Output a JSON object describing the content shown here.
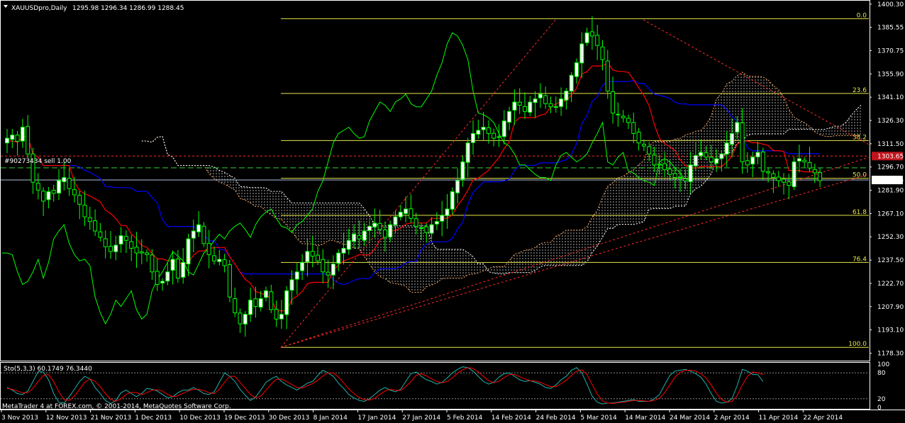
{
  "header": {
    "symbol": "XAUUSDpro,Daily",
    "ohlc": "1295.98 1296.34 1286.99 1288.45",
    "menu_icon": "triangle-down-icon"
  },
  "order_line": {
    "label": "#90273434 sell 1.00"
  },
  "footer": {
    "copyright": "MetaTrader 4 at FOREX.com, © 2001-2014, MetaQuotes Software Corp."
  },
  "colors": {
    "background": "#000000",
    "candle": "#00ff00",
    "candle_body": "#ffffff",
    "tenkan": "#ff0000",
    "kijun": "#0000ff",
    "chikou": "#00ff00",
    "fib": "#e6e64a",
    "grid_text": "#ffffff",
    "stoch_main": "#20b2aa",
    "stoch_signal": "#ff0000",
    "order_label_bg": "#c0131c"
  },
  "chart_data": [
    {
      "type": "candlestick",
      "title": "XAUUSDpro,Daily",
      "ylim": [
        1174,
        1402
      ],
      "y_ticks": [
        "1400.30",
        "1385.55",
        "1370.75",
        "1355.90",
        "1341.10",
        "1326.30",
        "1311.50",
        "1296.70",
        "1281.90",
        "1267.10",
        "1252.30",
        "1237.50",
        "1222.70",
        "1207.90",
        "1193.10",
        "1178.30"
      ],
      "x_ticks": [
        "3 Nov 2013",
        "12 Nov 2013",
        "21 Nov 2013",
        "1 Dec 2013",
        "10 Dec 2013",
        "19 Dec 2013",
        "30 Dec 2013",
        "8 Jan 2014",
        "17 Jan 2014",
        "27 Jan 2014",
        "5 Feb 2014",
        "14 Feb 2014",
        "24 Feb 2014",
        "5 Mar 2014",
        "14 Mar 2014",
        "24 Mar 2014",
        "2 Apr 2014",
        "11 Apr 2014",
        "22 Apr 2014"
      ],
      "series": [
        {
          "name": "XAUUSDpro",
          "closes": [
            1315,
            1317,
            1313,
            1322,
            1305,
            1287,
            1282,
            1275,
            1281,
            1280,
            1288,
            1290,
            1283,
            1279,
            1273,
            1265,
            1262,
            1256,
            1252,
            1246,
            1243,
            1247,
            1253,
            1250,
            1245,
            1242,
            1242,
            1241,
            1230,
            1222,
            1224,
            1230,
            1238,
            1226,
            1236,
            1251,
            1256,
            1260,
            1248,
            1241,
            1237,
            1238,
            1234,
            1214,
            1204,
            1197,
            1203,
            1212,
            1208,
            1213,
            1218,
            1206,
            1200,
            1203,
            1218,
            1225,
            1230,
            1236,
            1243,
            1240,
            1237,
            1230,
            1228,
            1235,
            1242,
            1245,
            1250,
            1254,
            1251,
            1256,
            1259,
            1261,
            1257,
            1252,
            1260,
            1265,
            1268,
            1270,
            1264,
            1259,
            1258,
            1255,
            1260,
            1262,
            1266,
            1270,
            1281,
            1288,
            1300,
            1312,
            1318,
            1320,
            1322,
            1318,
            1315,
            1316,
            1326,
            1332,
            1338,
            1336,
            1332,
            1338,
            1340,
            1343,
            1337,
            1335,
            1335,
            1340,
            1345,
            1355,
            1363,
            1375,
            1382,
            1380,
            1374,
            1365,
            1345,
            1331,
            1330,
            1328,
            1325,
            1318,
            1312,
            1310,
            1305,
            1298,
            1298,
            1295,
            1292,
            1290,
            1290,
            1288,
            1298,
            1304,
            1306,
            1303,
            1300,
            1302,
            1305,
            1312,
            1318,
            1325,
            1300,
            1298,
            1303,
            1306,
            1294,
            1293,
            1290,
            1288,
            1287,
            1285,
            1300,
            1302,
            1300,
            1296,
            1293,
            1288
          ],
          "last_price": "1288.45",
          "order_price": "1303.65"
        }
      ],
      "indicators": {
        "tenkan_sen": "red line",
        "kijun_sen": "blue line",
        "chikou_span": "green line",
        "kumo": "hatched cloud"
      },
      "annotations": {
        "fibonacci_levels": [
          {
            "label": "0.0",
            "price": 1391
          },
          {
            "label": "23.6",
            "price": 1343.5
          },
          {
            "label": "38.2",
            "price": 1313.5
          },
          {
            "label": "50.0",
            "price": 1289.5
          },
          {
            "label": "61.8",
            "price": 1266
          },
          {
            "label": "76.4",
            "price": 1236
          },
          {
            "label": "100.0",
            "price": 1182
          }
        ],
        "order_line_price": 1303.65,
        "trend_lines": "red dashed fan from 30 Dec 2013 low"
      }
    },
    {
      "type": "line",
      "title": "Sto(5,3,3) 60.1749 76.3440",
      "ylim": [
        0,
        100
      ],
      "y_ticks": [
        "100",
        "80",
        "20",
        "0"
      ],
      "series": [
        {
          "name": "main",
          "values": [
            46,
            40,
            32,
            30,
            38,
            60,
            83,
            82,
            64,
            32,
            12,
            10,
            25,
            42,
            60,
            72,
            66,
            46,
            32,
            16,
            9,
            16,
            34,
            40,
            32,
            25,
            32,
            44,
            42,
            38,
            30,
            22,
            25,
            34,
            40,
            40,
            46,
            40,
            32,
            30,
            36,
            58,
            80,
            72,
            60,
            42,
            28,
            16,
            24,
            40,
            58,
            66,
            72,
            60,
            52,
            46,
            40,
            48,
            56,
            60,
            74,
            86,
            80,
            72,
            56,
            44,
            30,
            22,
            16,
            14,
            20,
            30,
            40,
            46,
            40,
            36,
            42,
            60,
            78,
            82,
            72,
            64,
            60,
            54,
            58,
            68,
            80,
            88,
            94,
            92,
            84,
            72,
            60,
            54,
            58,
            70,
            78,
            80,
            72,
            64,
            60,
            62,
            58,
            54,
            46,
            44,
            52,
            64,
            72,
            86,
            92,
            80,
            54,
            26,
            12,
            8,
            10,
            10,
            12,
            14,
            16,
            18,
            14,
            14,
            14,
            20,
            30,
            52,
            74,
            84,
            86,
            88,
            84,
            78,
            70,
            54,
            32,
            14,
            10,
            12,
            20,
            50,
            88,
            84,
            76,
            76,
            60
          ]
        },
        {
          "name": "signal",
          "values": [
            44,
            42,
            38,
            34,
            34,
            44,
            60,
            74,
            76,
            60,
            36,
            18,
            16,
            26,
            42,
            58,
            66,
            60,
            48,
            32,
            19,
            14,
            20,
            30,
            35,
            34,
            30,
            34,
            40,
            41,
            38,
            30,
            25,
            27,
            33,
            38,
            42,
            42,
            39,
            34,
            32,
            42,
            58,
            72,
            72,
            58,
            44,
            30,
            22,
            26,
            40,
            54,
            65,
            66,
            60,
            53,
            46,
            45,
            50,
            55,
            63,
            73,
            80,
            80,
            70,
            57,
            43,
            32,
            23,
            18,
            17,
            21,
            30,
            38,
            42,
            40,
            39,
            48,
            60,
            74,
            78,
            73,
            66,
            60,
            57,
            60,
            68,
            79,
            87,
            92,
            90,
            82,
            72,
            62,
            57,
            61,
            69,
            76,
            76,
            71,
            66,
            62,
            61,
            58,
            53,
            48,
            48,
            55,
            63,
            74,
            84,
            87,
            76,
            53,
            31,
            15,
            10,
            9,
            11,
            12,
            14,
            16,
            16,
            15,
            14,
            16,
            21,
            34,
            52,
            70,
            81,
            86,
            86,
            84,
            78,
            68,
            52,
            33,
            18,
            12,
            14,
            27,
            52,
            72,
            82,
            80,
            76
          ]
        }
      ]
    }
  ]
}
